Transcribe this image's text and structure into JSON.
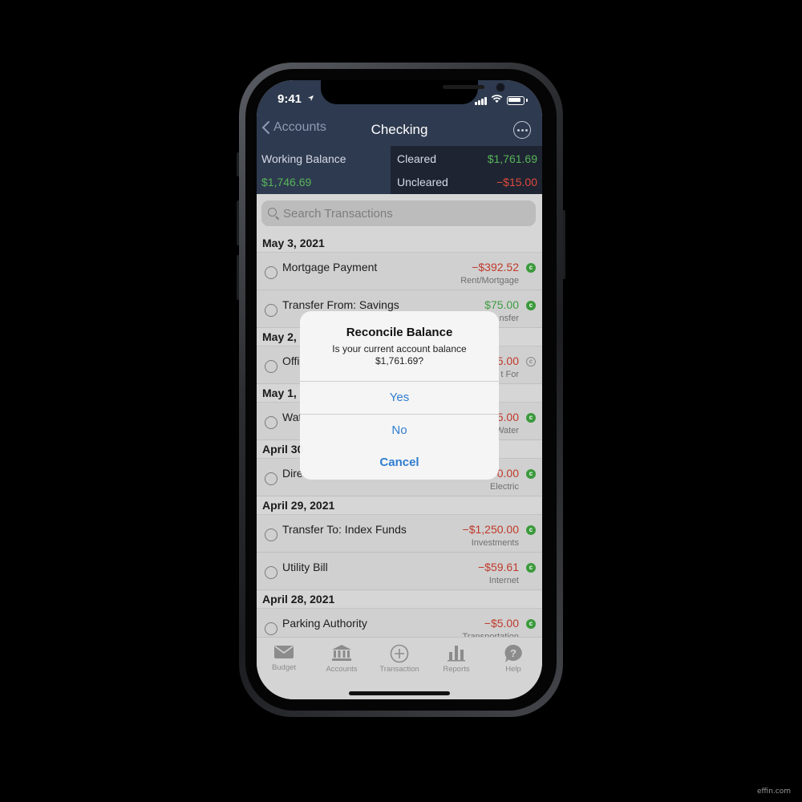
{
  "status": {
    "time": "9:41"
  },
  "nav": {
    "back_label": "Accounts",
    "title": "Checking"
  },
  "balance": {
    "working_label": "Working Balance",
    "working_value": "$1,746.69",
    "cleared_label": "Cleared",
    "cleared_value": "$1,761.69",
    "uncleared_label": "Uncleared",
    "uncleared_value": "−$15.00"
  },
  "search": {
    "placeholder": "Search Transactions"
  },
  "sections": [
    {
      "date": "May 3, 2021",
      "rows": [
        {
          "payee": "Mortgage Payment",
          "amount": "−$392.52",
          "category": "Rent/Mortgage",
          "sign": "neg",
          "status": "cleared"
        },
        {
          "payee": "Transfer From: Savings",
          "amount": "$75.00",
          "category": "nsfer",
          "sign": "pos",
          "status": "cleared"
        }
      ]
    },
    {
      "date": "May 2,",
      "rows": [
        {
          "payee": "Offi",
          "amount": "5.00",
          "category": "t For",
          "sign": "neg",
          "status": "uncleared"
        }
      ]
    },
    {
      "date": "May 1,",
      "rows": [
        {
          "payee": "Wat",
          "amount": "5.00",
          "category": "Water",
          "sign": "neg",
          "status": "cleared"
        }
      ]
    },
    {
      "date": "April 30",
      "rows": [
        {
          "payee": "Dire",
          "amount": "0.00",
          "category": "Electric",
          "sign": "neg",
          "status": "cleared"
        }
      ]
    },
    {
      "date": "April 29, 2021",
      "rows": [
        {
          "payee": "Transfer To: Index Funds",
          "amount": "−$1,250.00",
          "category": "Investments",
          "sign": "neg",
          "status": "cleared"
        },
        {
          "payee": "Utility Bill",
          "amount": "−$59.61",
          "category": "Internet",
          "sign": "neg",
          "status": "cleared"
        }
      ]
    },
    {
      "date": "April 28, 2021",
      "rows": [
        {
          "payee": "Parking Authority",
          "amount": "−$5.00",
          "category": "Transportation",
          "sign": "neg",
          "status": "cleared"
        }
      ]
    }
  ],
  "tabs": [
    {
      "label": "Budget",
      "icon": "envelope-icon"
    },
    {
      "label": "Accounts",
      "icon": "bank-icon"
    },
    {
      "label": "Transaction",
      "icon": "plus-circle-icon"
    },
    {
      "label": "Reports",
      "icon": "bar-chart-icon"
    },
    {
      "label": "Help",
      "icon": "help-bubble-icon"
    }
  ],
  "alert": {
    "title": "Reconcile Balance",
    "message": "Is your current account balance $1,761.69?",
    "yes_label": "Yes",
    "no_label": "No",
    "cancel_label": "Cancel"
  },
  "cleared_glyph": "c",
  "watermark": "effin.com",
  "colors": {
    "header": "#2e3a4f",
    "positive": "#3c9c40",
    "negative": "#c0392b",
    "link": "#2f7dd1"
  }
}
